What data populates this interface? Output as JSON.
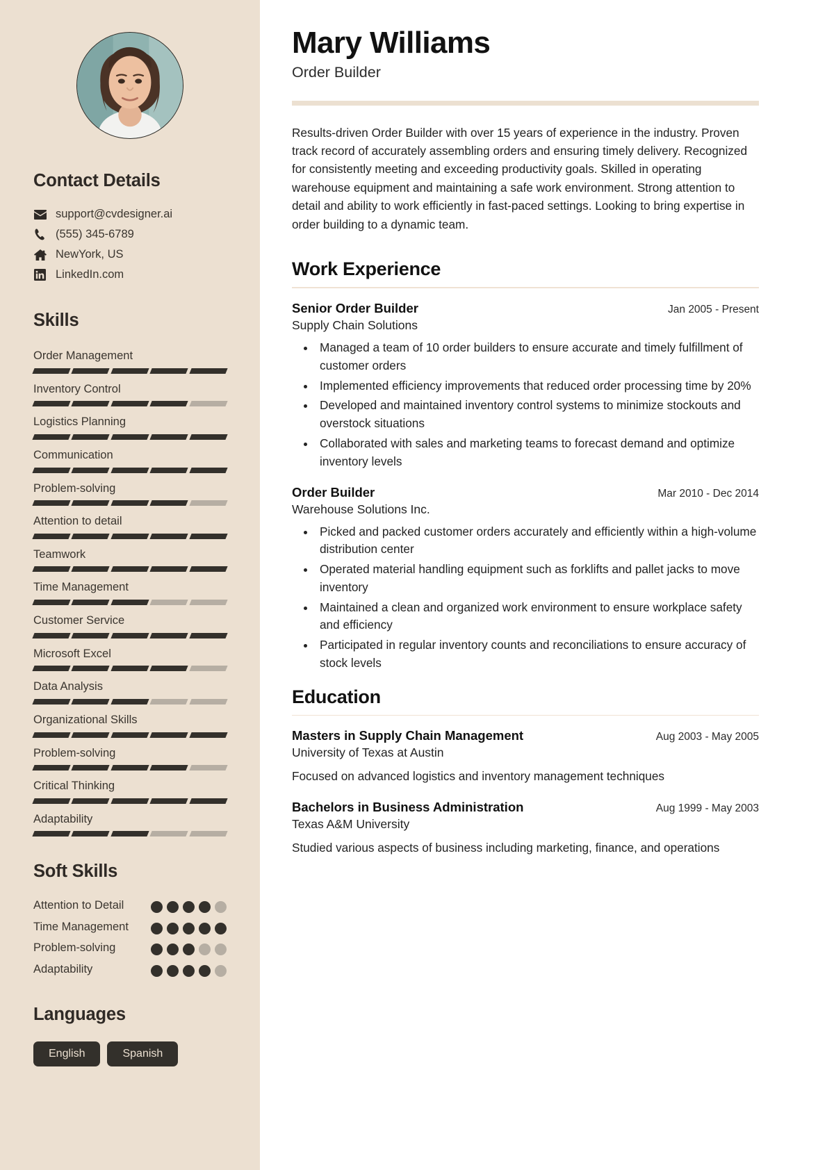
{
  "header": {
    "name": "Mary Williams",
    "role": "Order Builder"
  },
  "summary": "Results-driven Order Builder with over 15 years of experience in the industry. Proven track record of accurately assembling orders and ensuring timely delivery. Recognized for consistently meeting and exceeding productivity goals. Skilled in operating warehouse equipment and maintaining a safe work environment. Strong attention to detail and ability to work efficiently in fast-paced settings. Looking to bring expertise in order building to a dynamic team.",
  "sidebar": {
    "contact_heading": "Contact Details",
    "contact": [
      {
        "icon": "envelope-icon",
        "value": "support@cvdesigner.ai"
      },
      {
        "icon": "phone-icon",
        "value": "(555) 345-6789"
      },
      {
        "icon": "home-icon",
        "value": "NewYork, US"
      },
      {
        "icon": "linkedin-icon",
        "value": "LinkedIn.com"
      }
    ],
    "skills_heading": "Skills",
    "skills_max": 5,
    "skills": [
      {
        "name": "Order Management",
        "level": 5
      },
      {
        "name": "Inventory Control",
        "level": 4
      },
      {
        "name": "Logistics Planning",
        "level": 5
      },
      {
        "name": "Communication",
        "level": 5
      },
      {
        "name": "Problem-solving",
        "level": 4
      },
      {
        "name": "Attention to detail",
        "level": 5
      },
      {
        "name": "Teamwork",
        "level": 5
      },
      {
        "name": "Time Management",
        "level": 3
      },
      {
        "name": "Customer Service",
        "level": 5
      },
      {
        "name": "Microsoft Excel",
        "level": 4
      },
      {
        "name": "Data Analysis",
        "level": 3
      },
      {
        "name": "Organizational Skills",
        "level": 5
      },
      {
        "name": "Problem-solving",
        "level": 4
      },
      {
        "name": "Critical Thinking",
        "level": 5
      },
      {
        "name": "Adaptability",
        "level": 3
      }
    ],
    "soft_skills_heading": "Soft Skills",
    "soft_skills_max": 5,
    "soft_skills": [
      {
        "name": "Attention to Detail",
        "level": 4
      },
      {
        "name": "Time Management",
        "level": 5
      },
      {
        "name": "Problem-solving",
        "level": 3
      },
      {
        "name": "Adaptability",
        "level": 4
      }
    ],
    "languages_heading": "Languages",
    "languages": [
      "English",
      "Spanish"
    ]
  },
  "work": {
    "heading": "Work Experience",
    "entries": [
      {
        "title": "Senior Order Builder",
        "org": "Supply Chain Solutions",
        "date": "Jan 2005 - Present",
        "bullets": [
          "Managed a team of 10 order builders to ensure accurate and timely fulfillment of customer orders",
          "Implemented efficiency improvements that reduced order processing time by 20%",
          "Developed and maintained inventory control systems to minimize stockouts and overstock situations",
          "Collaborated with sales and marketing teams to forecast demand and optimize inventory levels"
        ]
      },
      {
        "title": "Order Builder",
        "org": "Warehouse Solutions Inc.",
        "date": "Mar 2010 - Dec 2014",
        "bullets": [
          "Picked and packed customer orders accurately and efficiently within a high-volume distribution center",
          "Operated material handling equipment such as forklifts and pallet jacks to move inventory",
          "Maintained a clean and organized work environment to ensure workplace safety and efficiency",
          "Participated in regular inventory counts and reconciliations to ensure accuracy of stock levels"
        ]
      }
    ]
  },
  "education": {
    "heading": "Education",
    "entries": [
      {
        "title": "Masters in Supply Chain Management",
        "org": "University of Texas at Austin",
        "date": "Aug 2003 - May 2005",
        "desc": "Focused on advanced logistics and inventory management techniques"
      },
      {
        "title": "Bachelors in Business Administration",
        "org": "Texas A&M University",
        "date": "Aug 1999 - May 2003",
        "desc": "Studied various aspects of business including marketing, finance, and operations"
      }
    ]
  },
  "colors": {
    "sidebar_bg": "#ece0d1",
    "dark": "#33302b",
    "muted": "#b6aea3",
    "accent_rule": "#ece0d1"
  }
}
